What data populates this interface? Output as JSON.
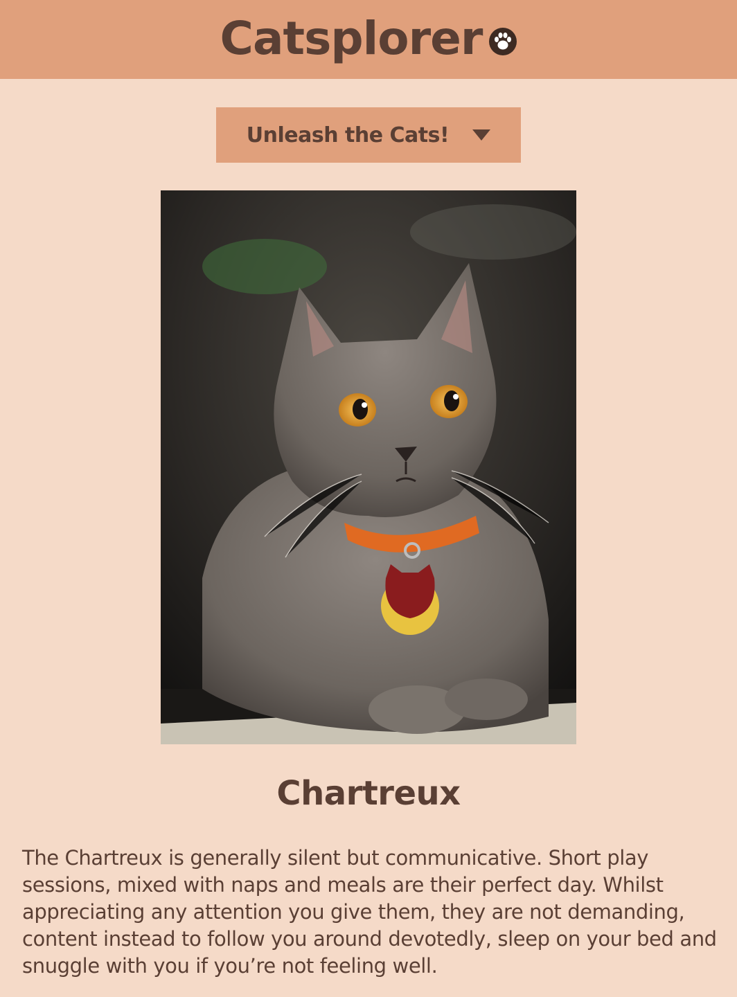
{
  "header": {
    "title": "Catsplorer",
    "logo_icon": "paw-icon",
    "background": "#e0a07c"
  },
  "dropdown": {
    "label": "Unleash the Cats!",
    "icon": "caret-down-icon"
  },
  "breed": {
    "image_description_icon": "cat-photo",
    "name": "Chartreux",
    "description": "The Chartreux is generally silent but communicative. Short play sessions, mixed with naps and meals are their perfect day. Whilst appreciating any attention you give them, they are not demanding, content instead to follow you around devotedly, sleep on your bed and snuggle with you if you’re not feeling well."
  },
  "colors": {
    "page_background": "#f5dac8",
    "accent": "#e0a07c",
    "text": "#5a3f34"
  }
}
